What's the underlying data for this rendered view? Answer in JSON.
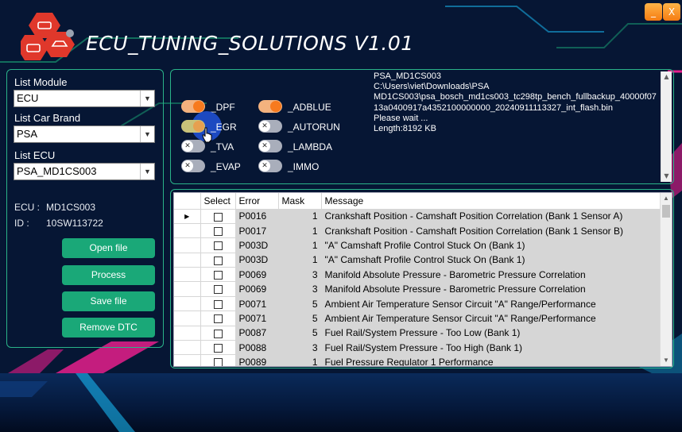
{
  "window": {
    "title": "ECU_TUNING_SOLUTIONS V1.01",
    "minimize_label": "_",
    "close_label": "X"
  },
  "left": {
    "module": {
      "label": "List Module",
      "value": "ECU"
    },
    "brand": {
      "label": "List Car Brand",
      "value": "PSA"
    },
    "ecu": {
      "label": "List ECU",
      "value": "PSA_MD1CS003"
    },
    "ecu_info": {
      "ecu_label": "ECU :",
      "ecu_value": "MD1CS003",
      "id_label": "ID :",
      "id_value": "10SW113722"
    },
    "buttons": {
      "open": "Open file",
      "process": "Process",
      "save": "Save file",
      "remove": "Remove DTC"
    }
  },
  "toggles": [
    {
      "label": "_DPF",
      "state": "on"
    },
    {
      "label": "_ADBLUE",
      "state": "on"
    },
    {
      "label": "_EGR",
      "state": "on"
    },
    {
      "label": "_AUTORUN",
      "state": "off"
    },
    {
      "label": "_TVA",
      "state": "off"
    },
    {
      "label": "_LAMBDA",
      "state": "off"
    },
    {
      "label": "_EVAP",
      "state": "off"
    },
    {
      "label": "_IMMO",
      "state": "off"
    }
  ],
  "log": {
    "lines": [
      "PSA_MD1CS003",
      "C:\\Users\\viet\\Downloads\\PSA",
      "MD1CS003\\psa_bosch_md1cs003_tc298tp_bench_fullbackup_40000f0713a0400917a4352100000000_20240911113327_int_flash.bin",
      "Please wait ...",
      "Length:8192 KB"
    ]
  },
  "table": {
    "columns": [
      "Select",
      "Error",
      "Mask",
      "Message"
    ],
    "rows": [
      {
        "error": "P0016",
        "mask": "1",
        "message": "Crankshaft Position - Camshaft Position Correlation (Bank 1 Sensor A)"
      },
      {
        "error": "P0017",
        "mask": "1",
        "message": "Crankshaft Position - Camshaft Position Correlation (Bank 1 Sensor B)"
      },
      {
        "error": "P003D",
        "mask": "1",
        "message": "\"A\" Camshaft Profile Control Stuck On (Bank 1)"
      },
      {
        "error": "P003D",
        "mask": "1",
        "message": "\"A\" Camshaft Profile Control Stuck On (Bank 1)"
      },
      {
        "error": "P0069",
        "mask": "3",
        "message": "Manifold Absolute Pressure - Barometric Pressure Correlation"
      },
      {
        "error": "P0069",
        "mask": "3",
        "message": "Manifold Absolute Pressure - Barometric Pressure Correlation"
      },
      {
        "error": "P0071",
        "mask": "5",
        "message": "Ambient Air Temperature Sensor Circuit \"A\" Range/Performance"
      },
      {
        "error": "P0071",
        "mask": "5",
        "message": "Ambient Air Temperature Sensor Circuit \"A\" Range/Performance"
      },
      {
        "error": "P0087",
        "mask": "5",
        "message": "Fuel Rail/System Pressure - Too Low (Bank 1)"
      },
      {
        "error": "P0088",
        "mask": "3",
        "message": "Fuel Rail/System Pressure - Too High (Bank 1)"
      },
      {
        "error": "P0089",
        "mask": "1",
        "message": "Fuel Pressure Regulator 1 Performance"
      }
    ]
  },
  "colors": {
    "accent_green": "#1aa878",
    "toggle_on": "#f77a1e",
    "deco_pink": "#e61e8c",
    "deco_cyan": "#19c3ff"
  }
}
